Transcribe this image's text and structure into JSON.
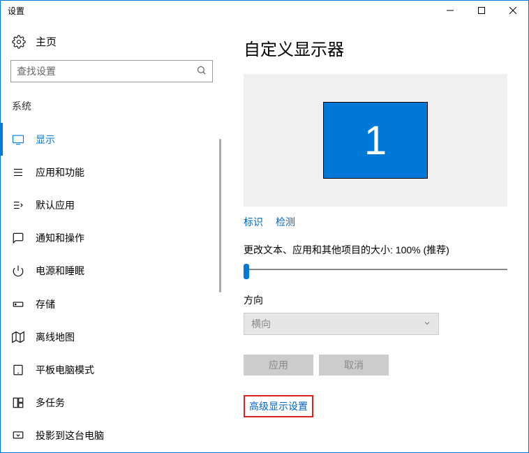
{
  "titlebar": {
    "title": "设置"
  },
  "home": {
    "label": "主页"
  },
  "search": {
    "placeholder": "查找设置"
  },
  "section": {
    "label": "系统"
  },
  "nav": {
    "items": [
      {
        "label": "显示"
      },
      {
        "label": "应用和功能"
      },
      {
        "label": "默认应用"
      },
      {
        "label": "通知和操作"
      },
      {
        "label": "电源和睡眠"
      },
      {
        "label": "存储"
      },
      {
        "label": "离线地图"
      },
      {
        "label": "平板电脑模式"
      },
      {
        "label": "多任务"
      },
      {
        "label": "投影到这台电脑"
      }
    ]
  },
  "main": {
    "heading": "自定义显示器",
    "monitor_number": "1",
    "identify_label": "标识",
    "detect_label": "检测",
    "scale_label": "更改文本、应用和其他项目的大小: 100% (推荐)",
    "orientation_label": "方向",
    "orientation_value": "横向",
    "apply_label": "应用",
    "cancel_label": "取消",
    "advanced_label": "高级显示设置"
  }
}
